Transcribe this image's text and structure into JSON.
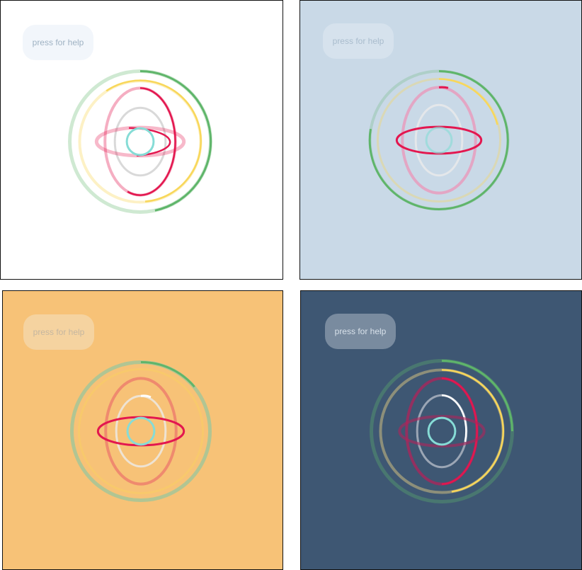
{
  "panels": [
    {
      "id": "light",
      "background": "#ffffff",
      "help_label": "press for help",
      "help_bg": "#f2f6fb",
      "help_fg": "#9fb2c3"
    },
    {
      "id": "blue",
      "background": "#c9d9e7",
      "help_label": "press for help",
      "help_bg": "#d6e2ed",
      "help_fg": "#a9bccd"
    },
    {
      "id": "orange",
      "background": "#f7c277",
      "help_label": "press for help",
      "help_bg": "#f5d3a0",
      "help_fg": "#c4b6a0"
    },
    {
      "id": "navy",
      "background": "#3e5773",
      "help_label": "press for help",
      "help_bg": "#798b9f",
      "help_fg": "#d8e1ea"
    }
  ],
  "colors": {
    "green": "#5fb56a",
    "yellow": "#f8d75a",
    "red": "#e3174f",
    "white": "#e6e6e6",
    "cyan": "#86dcd6"
  }
}
